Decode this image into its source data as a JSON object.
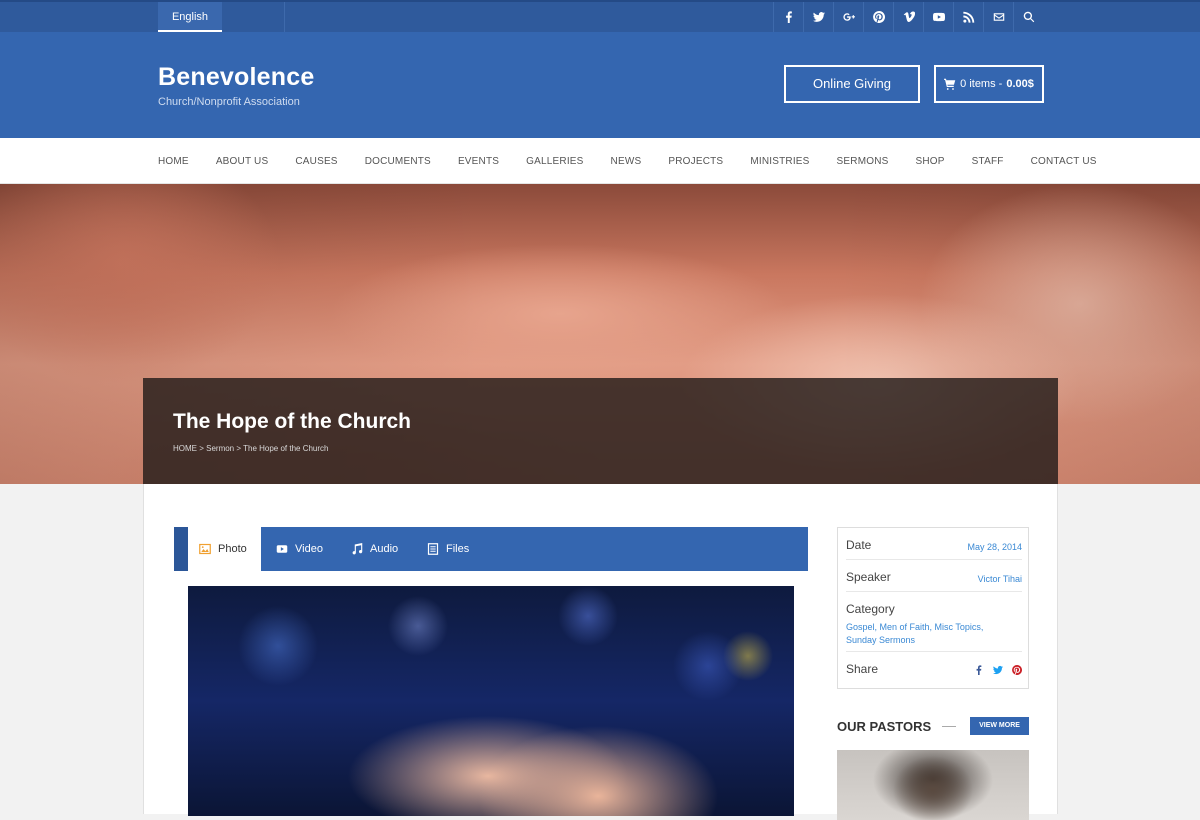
{
  "topbar": {
    "language": "English",
    "social_icons": [
      "facebook-icon",
      "twitter-icon",
      "google-plus-icon",
      "pinterest-icon",
      "vimeo-icon",
      "youtube-icon",
      "rss-icon",
      "mail-icon",
      "search-icon"
    ]
  },
  "header": {
    "title": "Benevolence",
    "subtitle": "Church/Nonprofit Association",
    "giving_label": "Online Giving",
    "cart_items": "0 items - ",
    "cart_total": "0.00$"
  },
  "nav": {
    "items": [
      "HOME",
      "ABOUT US",
      "CAUSES",
      "DOCUMENTS",
      "EVENTS",
      "GALLERIES",
      "NEWS",
      "PROJECTS",
      "MINISTRIES",
      "SERMONS",
      "SHOP",
      "STAFF",
      "CONTACT US"
    ]
  },
  "hero": {
    "title": "The Hope of the Church",
    "breadcrumb": "HOME > Sermon > The Hope of the Church"
  },
  "tabs": [
    {
      "label": "Photo",
      "icon": "photo-icon",
      "active": true
    },
    {
      "label": "Video",
      "icon": "video-icon",
      "active": false
    },
    {
      "label": "Audio",
      "icon": "music-note-icon",
      "active": false
    },
    {
      "label": "Files",
      "icon": "file-icon",
      "active": false
    }
  ],
  "details": {
    "date_label": "Date",
    "date_value": "May 28, 2014",
    "speaker_label": "Speaker",
    "speaker_value": "Victor Tihai",
    "category_label": "Category",
    "category_value": "Gospel, Men of Faith, Misc Topics, Sunday Sermons",
    "share_label": "Share"
  },
  "pastors": {
    "title": "OUR PASTORS",
    "view_more": "VIEW MORE"
  },
  "colors": {
    "primary": "#3466b0",
    "topbar": "#2f5a9c",
    "link": "#3a89d4",
    "pinterest": "#cb2027",
    "facebook": "#3b5998",
    "twitter": "#1da1f2"
  }
}
